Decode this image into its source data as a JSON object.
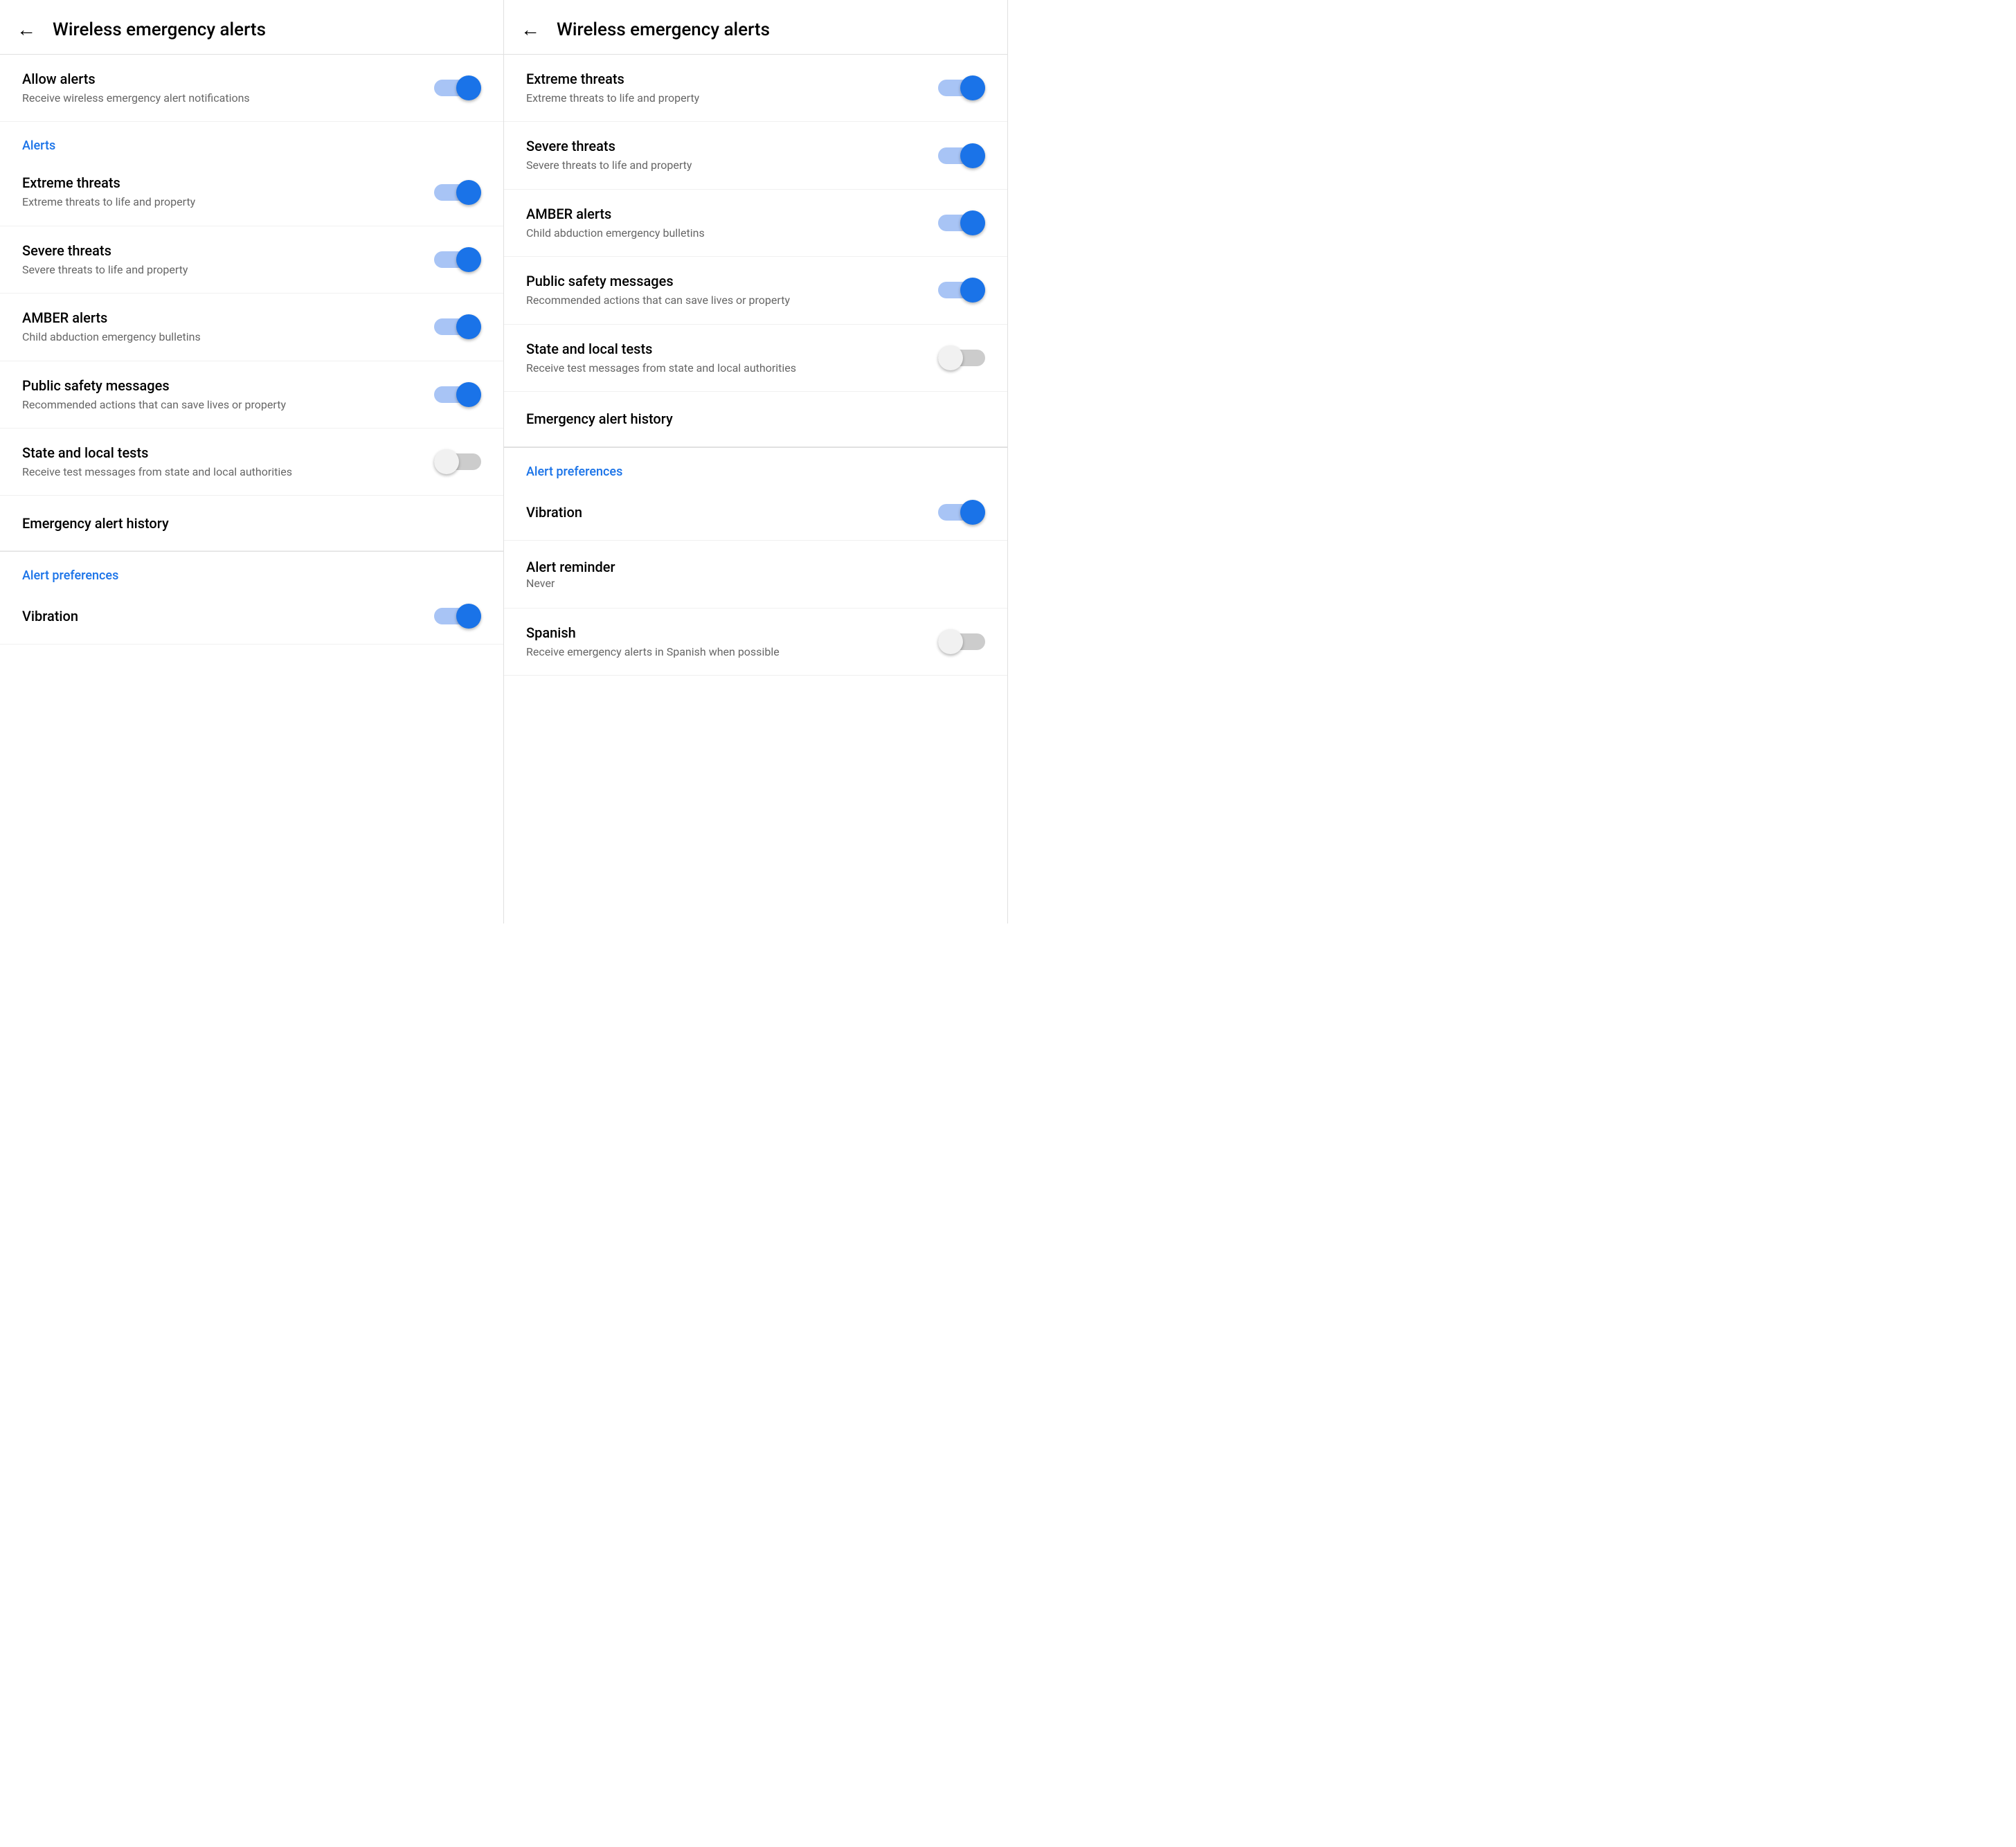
{
  "panel1": {
    "header": {
      "back_label": "←",
      "title": "Wireless emergency alerts"
    },
    "allow_alerts": {
      "title": "Allow alerts",
      "subtitle": "Receive wireless emergency alert notifications",
      "toggle_on": true
    },
    "alerts_section_label": "Alerts",
    "alert_items": [
      {
        "id": "extreme-threats",
        "title": "Extreme threats",
        "subtitle": "Extreme threats to life and property",
        "toggle_on": true
      },
      {
        "id": "severe-threats",
        "title": "Severe threats",
        "subtitle": "Severe threats to life and property",
        "toggle_on": true
      },
      {
        "id": "amber-alerts",
        "title": "AMBER alerts",
        "subtitle": "Child abduction emergency bulletins",
        "toggle_on": true
      },
      {
        "id": "public-safety",
        "title": "Public safety messages",
        "subtitle": "Recommended actions that can save lives or property",
        "toggle_on": true
      },
      {
        "id": "state-local-tests",
        "title": "State and local tests",
        "subtitle": "Receive test messages from state and local authorities",
        "toggle_on": false
      }
    ],
    "emergency_history_label": "Emergency alert history",
    "preferences_section_label": "Alert preferences",
    "vibration": {
      "title": "Vibration",
      "toggle_on": true
    }
  },
  "panel2": {
    "header": {
      "back_label": "←",
      "title": "Wireless emergency alerts"
    },
    "alert_items": [
      {
        "id": "extreme-threats",
        "title": "Extreme threats",
        "subtitle": "Extreme threats to life and property",
        "toggle_on": true
      },
      {
        "id": "severe-threats",
        "title": "Severe threats",
        "subtitle": "Severe threats to life and property",
        "toggle_on": true
      },
      {
        "id": "amber-alerts",
        "title": "AMBER alerts",
        "subtitle": "Child abduction emergency bulletins",
        "toggle_on": true
      },
      {
        "id": "public-safety",
        "title": "Public safety messages",
        "subtitle": "Recommended actions that can save lives or property",
        "toggle_on": true
      },
      {
        "id": "state-local-tests",
        "title": "State and local tests",
        "subtitle": "Receive test messages from state and local authorities",
        "toggle_on": false
      }
    ],
    "emergency_history_label": "Emergency alert history",
    "preferences_section_label": "Alert preferences",
    "preference_items": [
      {
        "id": "vibration",
        "title": "Vibration",
        "subtitle": null,
        "toggle_on": true,
        "type": "toggle"
      },
      {
        "id": "alert-reminder",
        "title": "Alert reminder",
        "subtitle": "Never",
        "type": "value"
      },
      {
        "id": "spanish",
        "title": "Spanish",
        "subtitle": "Receive emergency alerts in Spanish when possible",
        "toggle_on": false,
        "type": "toggle"
      }
    ]
  }
}
